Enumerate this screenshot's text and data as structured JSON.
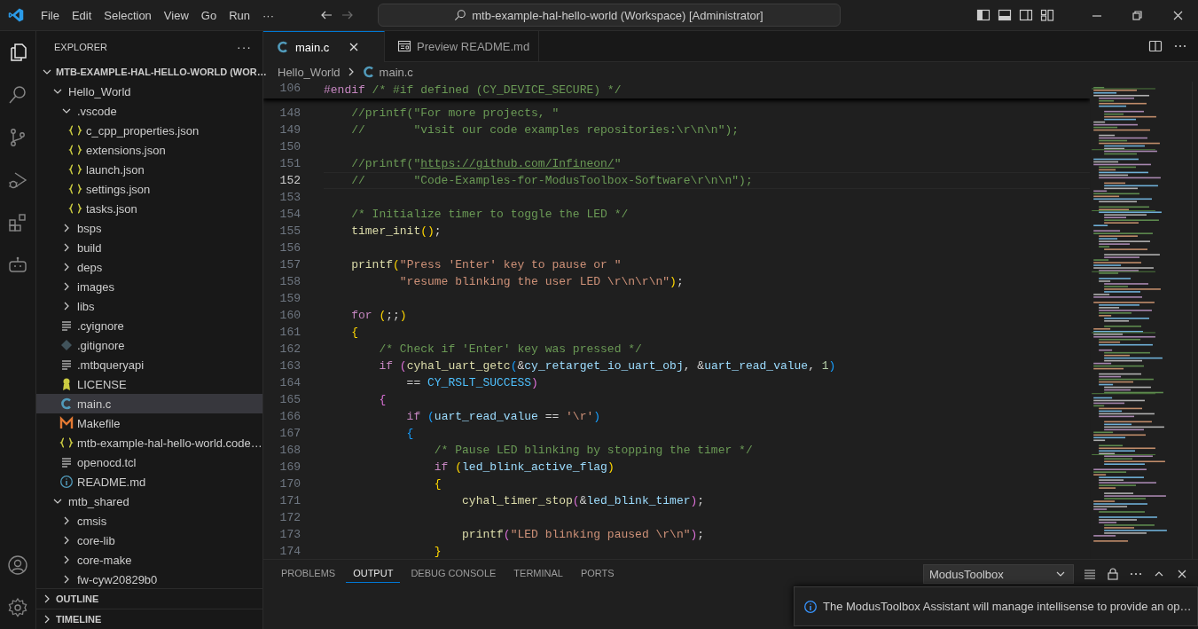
{
  "title_bar": {
    "menus": [
      "File",
      "Edit",
      "Selection",
      "View",
      "Go",
      "Run"
    ],
    "more": "···",
    "command_center": "mtb-example-hal-hello-world (Workspace) [Administrator]"
  },
  "activity_bar": {
    "top": [
      {
        "kind": "files",
        "selected": true
      },
      {
        "kind": "search",
        "selected": false
      },
      {
        "kind": "branch",
        "selected": false
      },
      {
        "kind": "debug",
        "selected": false
      },
      {
        "kind": "extensions",
        "selected": false
      },
      {
        "kind": "robot",
        "selected": false
      }
    ],
    "bottom": [
      {
        "kind": "account",
        "selected": false
      },
      {
        "kind": "settings",
        "selected": false
      }
    ]
  },
  "sidebar": {
    "title": "EXPLORER",
    "more": "···",
    "sections": [
      {
        "label": "MTB-EXAMPLE-HAL-HELLO-WORLD (WOR…",
        "expanded": true,
        "tree": [
          {
            "label": "Hello_World",
            "kind": "folder",
            "expanded": true,
            "selected": false,
            "children": [
              {
                "label": ".vscode",
                "kind": "folder",
                "expanded": true,
                "selected": false,
                "children": [
                  {
                    "label": "c_cpp_properties.json",
                    "kind": "json",
                    "selected": false
                  },
                  {
                    "label": "extensions.json",
                    "kind": "json",
                    "selected": false
                  },
                  {
                    "label": "launch.json",
                    "kind": "json",
                    "selected": false
                  },
                  {
                    "label": "settings.json",
                    "kind": "json",
                    "selected": false
                  },
                  {
                    "label": "tasks.json",
                    "kind": "json",
                    "selected": false
                  }
                ]
              },
              {
                "label": "bsps",
                "kind": "folder",
                "expanded": false,
                "selected": false
              },
              {
                "label": "build",
                "kind": "folder",
                "expanded": false,
                "selected": false
              },
              {
                "label": "deps",
                "kind": "folder",
                "expanded": false,
                "selected": false
              },
              {
                "label": "images",
                "kind": "folder",
                "expanded": false,
                "selected": false
              },
              {
                "label": "libs",
                "kind": "folder",
                "expanded": false,
                "selected": false
              },
              {
                "label": ".cyignore",
                "kind": "text",
                "selected": false
              },
              {
                "label": ".gitignore",
                "kind": "git",
                "selected": false
              },
              {
                "label": ".mtbqueryapi",
                "kind": "text",
                "selected": false
              },
              {
                "label": "LICENSE",
                "kind": "license",
                "selected": false
              },
              {
                "label": "main.c",
                "kind": "c",
                "selected": true
              },
              {
                "label": "Makefile",
                "kind": "makefile",
                "selected": false
              },
              {
                "label": "mtb-example-hal-hello-world.code…",
                "kind": "json",
                "selected": false
              },
              {
                "label": "openocd.tcl",
                "kind": "text",
                "selected": false
              },
              {
                "label": "README.md",
                "kind": "info",
                "selected": false
              }
            ]
          },
          {
            "label": "mtb_shared",
            "kind": "folder",
            "expanded": true,
            "selected": false,
            "children": [
              {
                "label": "cmsis",
                "kind": "folder",
                "expanded": false,
                "selected": false
              },
              {
                "label": "core-lib",
                "kind": "folder",
                "expanded": false,
                "selected": false
              },
              {
                "label": "core-make",
                "kind": "folder",
                "expanded": false,
                "selected": false
              },
              {
                "label": "fw-cyw20829b0",
                "kind": "folder",
                "expanded": false,
                "selected": false
              }
            ]
          }
        ]
      },
      {
        "label": "OUTLINE",
        "expanded": false
      },
      {
        "label": "TIMELINE",
        "expanded": false
      }
    ]
  },
  "editor": {
    "tabs": [
      {
        "label": "main.c",
        "kind": "c",
        "selected": true
      },
      {
        "label": "Preview README.md",
        "kind": "preview",
        "selected": false
      }
    ],
    "breadcrumb": [
      {
        "label": "Hello_World"
      },
      {
        "label": "main.c",
        "kind": "c"
      }
    ],
    "sticky_line": {
      "number": "106",
      "tokens": [
        {
          "kind": "keyword",
          "text": "#endif"
        },
        {
          "kind": "comment",
          "text": " /* #if defined (CY_DEVICE_SECURE) */"
        }
      ]
    },
    "lines": [
      {
        "number": "148",
        "current": false,
        "tokens": [
          {
            "kind": "comment",
            "text": "    //printf(\"For more projects, \""
          }
        ]
      },
      {
        "number": "149",
        "current": false,
        "tokens": [
          {
            "kind": "comment",
            "text": "    //       \"visit our code examples repositories:\\r\\n\\n\");"
          }
        ]
      },
      {
        "number": "150",
        "current": false
      },
      {
        "number": "151",
        "current": false,
        "tokens": [
          {
            "kind": "comment",
            "text": "    //printf(\""
          },
          {
            "kind": "link",
            "text": "https://github.com/Infineon/"
          },
          {
            "kind": "comment",
            "text": "\""
          }
        ]
      },
      {
        "number": "152",
        "current": true,
        "tokens": [
          {
            "kind": "comment",
            "text": "    //       \"Code-Examples-for-ModusToolbox-Software\\r\\n\\n\");"
          }
        ]
      },
      {
        "number": "153",
        "current": false
      },
      {
        "number": "154",
        "current": false,
        "tokens": [
          {
            "kind": "comment",
            "text": "    /* Initialize timer to toggle the LED */"
          }
        ]
      },
      {
        "number": "155",
        "current": false,
        "tokens": [
          {
            "kind": "func",
            "text": "    timer_init"
          },
          {
            "kind": "bracket1",
            "text": "()"
          },
          {
            "kind": "plain",
            "text": ";"
          }
        ]
      },
      {
        "number": "156",
        "current": false
      },
      {
        "number": "157",
        "current": false,
        "tokens": [
          {
            "kind": "func",
            "text": "    printf"
          },
          {
            "kind": "bracket1",
            "text": "("
          },
          {
            "kind": "string",
            "text": "\"Press 'Enter' key to pause or \""
          }
        ]
      },
      {
        "number": "158",
        "current": false,
        "tokens": [
          {
            "kind": "string",
            "text": "           \"resume blinking the user LED \\r\\n\\r\\n\""
          },
          {
            "kind": "bracket1",
            "text": ")"
          },
          {
            "kind": "plain",
            "text": ";"
          }
        ]
      },
      {
        "number": "159",
        "current": false
      },
      {
        "number": "160",
        "current": false,
        "tokens": [
          {
            "kind": "keyword",
            "text": "    for"
          },
          {
            "kind": "bracket1",
            "text": " ("
          },
          {
            "kind": "plain",
            "text": ";;"
          },
          {
            "kind": "bracket1",
            "text": ")"
          }
        ]
      },
      {
        "number": "161",
        "current": false,
        "tokens": [
          {
            "kind": "bracket1",
            "text": "    {"
          }
        ]
      },
      {
        "number": "162",
        "current": false,
        "tokens": [
          {
            "kind": "comment",
            "text": "        /* Check if 'Enter' key was pressed */"
          }
        ]
      },
      {
        "number": "163",
        "current": false,
        "tokens": [
          {
            "kind": "keyword",
            "text": "        if"
          },
          {
            "kind": "bracket2",
            "text": " ("
          },
          {
            "kind": "func",
            "text": "cyhal_uart_getc"
          },
          {
            "kind": "bracket3",
            "text": "("
          },
          {
            "kind": "plain",
            "text": "&"
          },
          {
            "kind": "var",
            "text": "cy_retarget_io_uart_obj"
          },
          {
            "kind": "plain",
            "text": ", &"
          },
          {
            "kind": "var",
            "text": "uart_read_value"
          },
          {
            "kind": "plain",
            "text": ","
          },
          {
            "kind": "number",
            "text": " 1"
          },
          {
            "kind": "bracket3",
            "text": ")"
          }
        ]
      },
      {
        "number": "164",
        "current": false,
        "tokens": [
          {
            "kind": "plain",
            "text": "            =="
          },
          {
            "kind": "const",
            "text": " CY_RSLT_SUCCESS"
          },
          {
            "kind": "bracket2",
            "text": ")"
          }
        ]
      },
      {
        "number": "165",
        "current": false,
        "tokens": [
          {
            "kind": "bracket2",
            "text": "        {"
          }
        ]
      },
      {
        "number": "166",
        "current": false,
        "tokens": [
          {
            "kind": "keyword",
            "text": "            if"
          },
          {
            "kind": "bracket3",
            "text": " ("
          },
          {
            "kind": "var",
            "text": "uart_read_value"
          },
          {
            "kind": "plain",
            "text": " =="
          },
          {
            "kind": "string",
            "text": " '\\r'"
          },
          {
            "kind": "bracket3",
            "text": ")"
          }
        ]
      },
      {
        "number": "167",
        "current": false,
        "tokens": [
          {
            "kind": "bracket3",
            "text": "            {"
          }
        ]
      },
      {
        "number": "168",
        "current": false,
        "tokens": [
          {
            "kind": "comment",
            "text": "                /* Pause LED blinking by stopping the timer */"
          }
        ]
      },
      {
        "number": "169",
        "current": false,
        "tokens": [
          {
            "kind": "keyword",
            "text": "                if"
          },
          {
            "kind": "bracket1",
            "text": " ("
          },
          {
            "kind": "var",
            "text": "led_blink_active_flag"
          },
          {
            "kind": "bracket1",
            "text": ")"
          }
        ]
      },
      {
        "number": "170",
        "current": false,
        "tokens": [
          {
            "kind": "bracket1",
            "text": "                {"
          }
        ]
      },
      {
        "number": "171",
        "current": false,
        "tokens": [
          {
            "kind": "func",
            "text": "                    cyhal_timer_stop"
          },
          {
            "kind": "bracket2",
            "text": "("
          },
          {
            "kind": "plain",
            "text": "&"
          },
          {
            "kind": "var",
            "text": "led_blink_timer"
          },
          {
            "kind": "bracket2",
            "text": ")"
          },
          {
            "kind": "plain",
            "text": ";"
          }
        ]
      },
      {
        "number": "172",
        "current": false
      },
      {
        "number": "173",
        "current": false,
        "tokens": [
          {
            "kind": "func",
            "text": "                    printf"
          },
          {
            "kind": "bracket2",
            "text": "("
          },
          {
            "kind": "string",
            "text": "\"LED blinking paused \\r\\n\""
          },
          {
            "kind": "bracket2",
            "text": ")"
          },
          {
            "kind": "plain",
            "text": ";"
          }
        ]
      },
      {
        "number": "174",
        "current": false,
        "tokens": [
          {
            "kind": "bracket1",
            "text": "                }"
          }
        ]
      }
    ]
  },
  "panel": {
    "tabs": [
      {
        "label": "PROBLEMS",
        "selected": false
      },
      {
        "label": "OUTPUT",
        "selected": true
      },
      {
        "label": "DEBUG CONSOLE",
        "selected": false
      },
      {
        "label": "TERMINAL",
        "selected": false
      },
      {
        "label": "PORTS",
        "selected": false
      }
    ],
    "dropdown": "ModusToolbox"
  },
  "notification": {
    "text": "The ModusToolbox Assistant will manage intellisense to provide an op…"
  }
}
